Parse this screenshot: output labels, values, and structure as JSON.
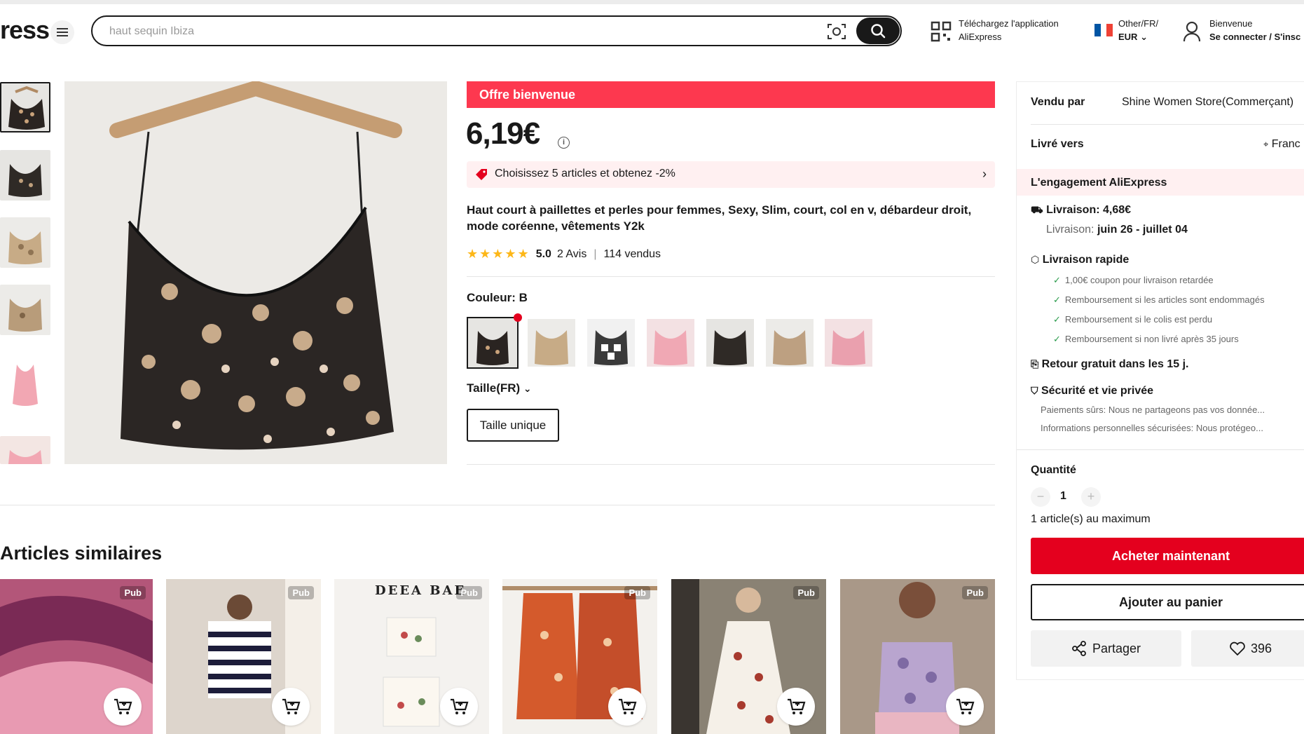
{
  "header": {
    "logo": "ress",
    "search_placeholder": "haut sequin Ibiza",
    "app_line1": "Téléchargez l'application",
    "app_line2": "AliExpress",
    "region_line1": "Other/FR/",
    "region_line2": "EUR",
    "account_line1": "Bienvenue",
    "account_line2": "Se connecter / S'insc"
  },
  "product": {
    "welcome_banner": "Offre bienvenue",
    "price": "6,19€",
    "promo_text": "Choisissez 5 articles et obtenez -2%",
    "title": "Haut court à paillettes et perles pour femmes, Sexy, Slim, court, col en v, débardeur droit, mode coréenne, vêtements Y2k",
    "rating_value": "5.0",
    "reviews": "2 Avis",
    "sold": "114 vendus",
    "stars": 5,
    "color_label": "Couleur: B",
    "size_label": "Taille(FR)",
    "size_option": "Taille unique"
  },
  "similar": {
    "title": "Articles similaires",
    "pub_label": "Pub",
    "brand_text": "DEEA BAE"
  },
  "panel": {
    "sold_by_label": "Vendu par",
    "sold_by_value": "Shine Women Store(Commerçant)",
    "ship_to_label": "Livré vers",
    "ship_to_value": "Franc",
    "engagement": "L'engagement AliExpress",
    "delivery_fee": "Livraison: 4,68€",
    "delivery_date_label": "Livraison:",
    "delivery_date": "juin 26 - juillet 04",
    "fast_delivery": "Livraison rapide",
    "bullets": [
      "1,00€ coupon pour livraison retardée",
      "Remboursement si les articles sont endommagés",
      "Remboursement si le colis est perdu",
      "Remboursement si non livré après 35 jours"
    ],
    "free_return": "Retour gratuit dans les 15 j.",
    "security": "Sécurité et vie privée",
    "security_line1": "Paiements sûrs: Nous ne partageons pas vos donnée...",
    "security_line2": "Informations personnelles sécurisées: Nous protégeo...",
    "quantity_label": "Quantité",
    "quantity_value": "1",
    "max_note": "1 article(s) au maximum",
    "buy_now": "Acheter maintenant",
    "add_to_cart": "Ajouter au panier",
    "share": "Partager",
    "wishlist_count": "396"
  },
  "colors": {
    "accent_red": "#fd384f",
    "buy_red": "#e4001e",
    "star_yellow": "#fdb718"
  }
}
